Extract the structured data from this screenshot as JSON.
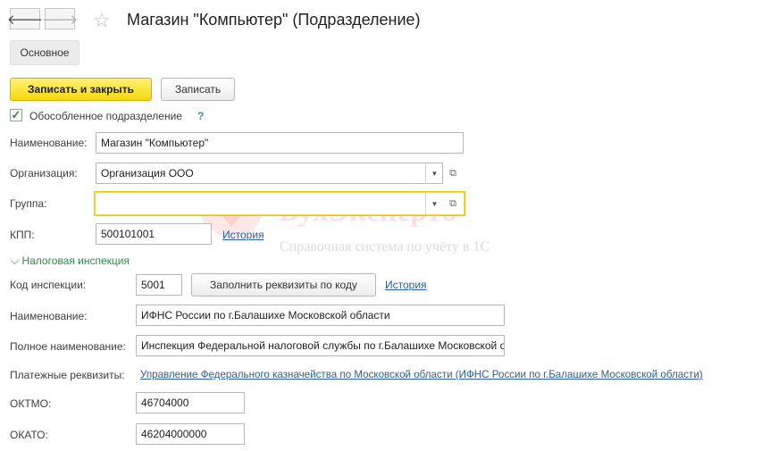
{
  "window": {
    "back_icon": "arrow-left-icon",
    "forward_icon": "arrow-right-icon",
    "favorite_icon": "star-icon",
    "title": "Магазин \"Компьютер\" (Подразделение)"
  },
  "tabs": {
    "main": "Основное"
  },
  "toolbar": {
    "save_close": "Записать и закрыть",
    "save": "Записать"
  },
  "form": {
    "separate_division": {
      "label": "Обособленное подразделение",
      "checked": true,
      "help": "?"
    },
    "name": {
      "label": "Наименование:",
      "value": "Магазин \"Компьютер\""
    },
    "organization": {
      "label": "Организация:",
      "value": "Организация ООО"
    },
    "group": {
      "label": "Группа:",
      "value": ""
    },
    "kpp": {
      "label": "КПП:",
      "value": "500101001",
      "history": "История"
    }
  },
  "tax_inspection": {
    "section_title": "Налоговая инспекция",
    "code": {
      "label": "Код инспекции:",
      "value": "5001"
    },
    "fill_button": "Заполнить реквизиты по коду",
    "history": "История",
    "name": {
      "label": "Наименование:",
      "value": "ИФНС России по г.Балашихе Московской области"
    },
    "full_name": {
      "label": "Полное наименование:",
      "value": "Инспекция Федеральной налоговой службы по г.Балашихе Московской области"
    },
    "payment_details": {
      "label": "Платежные реквизиты:",
      "value": "Управление Федерального казначейства по Московской области (ИФНС России по г.Балашихе Московской области)"
    },
    "oktmo": {
      "label": "ОКТМО:",
      "value": "46704000"
    },
    "okato": {
      "label": "ОКАТО:",
      "value": "46204000000"
    }
  },
  "watermark": {
    "brand": "БухЭксперт8",
    "tagline": "Справочная система по учёту в 1С",
    "accent": "#e8453c"
  }
}
